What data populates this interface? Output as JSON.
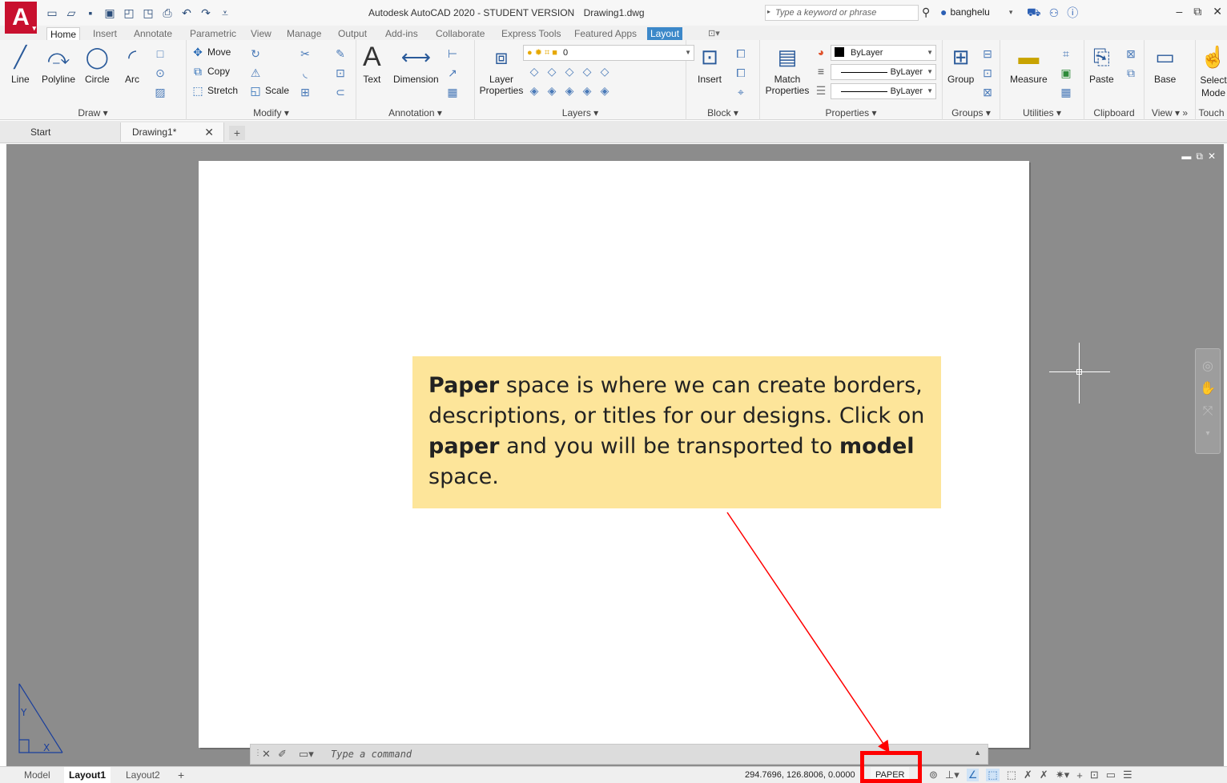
{
  "titlebar": {
    "app_logo": "A",
    "window_title": "Autodesk AutoCAD 2020 - STUDENT VERSION",
    "file_name": "Drawing1.dwg",
    "search_placeholder": "Type a keyword or phrase",
    "username": "banghelu"
  },
  "ribbon_tabs": [
    "Home",
    "Insert",
    "Annotate",
    "Parametric",
    "View",
    "Manage",
    "Output",
    "Add-ins",
    "Collaborate",
    "Express Tools",
    "Featured Apps",
    "Layout"
  ],
  "ribbon": {
    "draw": {
      "title": "Draw",
      "tools": [
        "Line",
        "Polyline",
        "Circle",
        "Arc"
      ]
    },
    "modify": {
      "title": "Modify",
      "move": "Move",
      "copy": "Copy",
      "stretch": "Stretch",
      "scale": "Scale"
    },
    "annotation": {
      "title": "Annotation",
      "text": "Text",
      "dimension": "Dimension"
    },
    "layers": {
      "title": "Layers",
      "layer_properties": "Layer Properties",
      "current_layer": "0"
    },
    "block": {
      "title": "Block",
      "insert": "Insert"
    },
    "properties": {
      "title": "Properties",
      "match_properties": "Match Properties",
      "color": "ByLayer",
      "linetype": "ByLayer",
      "lineweight": "ByLayer"
    },
    "groups": {
      "title": "Groups",
      "group": "Group"
    },
    "utilities": {
      "title": "Utilities",
      "measure": "Measure"
    },
    "clipboard": {
      "title": "Clipboard",
      "paste": "Paste"
    },
    "view": {
      "title": "View",
      "base": "Base"
    },
    "touch": {
      "title": "Touch",
      "select_mode": "Select Mode"
    }
  },
  "doc_tabs": {
    "start": "Start",
    "drawing": "Drawing1*"
  },
  "callout": {
    "parts": [
      {
        "text": "Paper",
        "bold": true
      },
      {
        "text": " space is where we can create borders, descriptions, or titles for our designs. Click on ",
        "bold": false
      },
      {
        "text": "paper",
        "bold": true
      },
      {
        "text": " and you will be transported to ",
        "bold": false
      },
      {
        "text": "model",
        "bold": true
      },
      {
        "text": " space.",
        "bold": false
      }
    ]
  },
  "command_line": {
    "placeholder": "Type a command"
  },
  "statusbar": {
    "layout_tabs": [
      "Model",
      "Layout1",
      "Layout2"
    ],
    "active_layout": "Layout1",
    "coordinates": "294.7696, 126.8006, 0.0000",
    "space_button": "PAPER"
  },
  "colors": {
    "callout_bg": "#fde59a",
    "highlight": "#ff0000",
    "layout_tab": "#3c88c9",
    "app_logo": "#c8102e"
  }
}
